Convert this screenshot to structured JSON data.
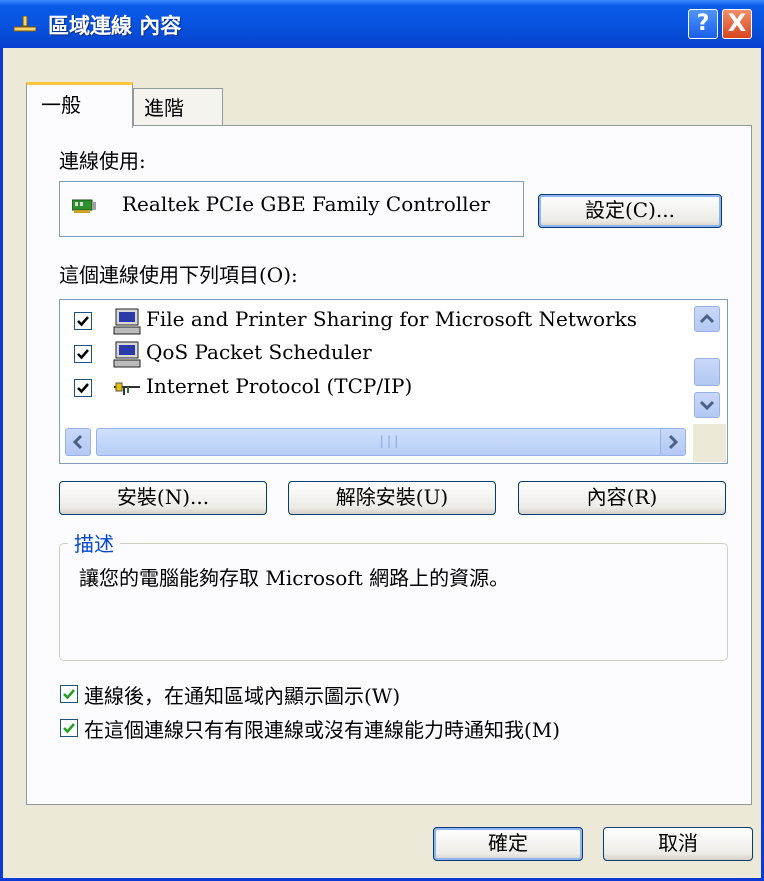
{
  "window": {
    "title": "區域連線 內容",
    "help_glyph": "?",
    "close_glyph": "X"
  },
  "tabs": [
    {
      "label": "一般",
      "active": true
    },
    {
      "label": "進階",
      "active": false
    }
  ],
  "connect_using": {
    "label": "連線使用:",
    "adapter_name": "Realtek PCIe GBE Family Controller",
    "configure_button": "設定(C)..."
  },
  "components": {
    "label": "這個連線使用下列項目(O):",
    "items": [
      {
        "label": "File and Printer Sharing for Microsoft Networks",
        "checked": true,
        "icon": "network-service-icon"
      },
      {
        "label": "QoS Packet Scheduler",
        "checked": true,
        "icon": "network-service-icon"
      },
      {
        "label": "Internet Protocol (TCP/IP)",
        "checked": true,
        "icon": "network-protocol-icon"
      }
    ],
    "install_button": "安裝(N)...",
    "uninstall_button": "解除安裝(U)",
    "properties_button": "內容(R)"
  },
  "description": {
    "title": "描述",
    "text": "讓您的電腦能夠存取 Microsoft 網路上的資源。"
  },
  "options": [
    {
      "label": "連線後，在通知區域內顯示圖示(W)",
      "checked": true
    },
    {
      "label": "在這個連線只有有限連線或沒有連線能力時通知我(M)",
      "checked": true
    }
  ],
  "footer": {
    "ok_button": "確定",
    "cancel_button": "取消"
  },
  "colors": {
    "titlebar": "#0753df",
    "dialog_bg": "#ece9d8",
    "tab_highlight": "#ffc83c",
    "group_title": "#0046d5",
    "check_green": "#21a121"
  }
}
